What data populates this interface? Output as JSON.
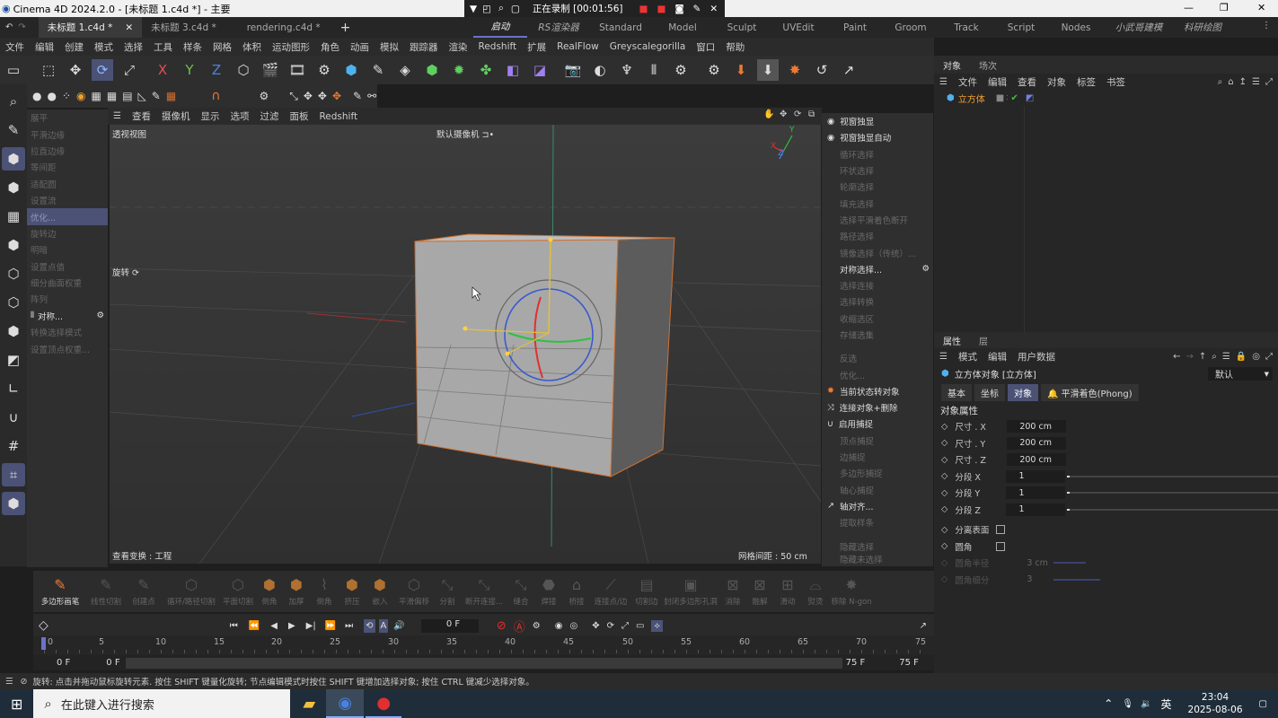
{
  "titlebar": {
    "title": "Cinema 4D 2024.2.0 - [未标题 1.c4d *] - 主要",
    "recording": "正在录制 [00:01:56]"
  },
  "file_tabs": [
    "未标题 1.c4d *",
    "未标题 3.c4d *",
    "rendering.c4d *"
  ],
  "layouts": [
    "启动",
    "RS渲染器",
    "Standard",
    "Model",
    "Sculpt",
    "UVEdit",
    "Paint",
    "Groom",
    "Track",
    "Script",
    "Nodes",
    "小武哥建模",
    "科研绘图"
  ],
  "menu": [
    "文件",
    "编辑",
    "创建",
    "模式",
    "选择",
    "工具",
    "样条",
    "网格",
    "体积",
    "运动图形",
    "角色",
    "动画",
    "模拟",
    "跟踪器",
    "渲染",
    "Redshift",
    "扩展",
    "RealFlow",
    "Greyscalegorilla",
    "窗口",
    "帮助"
  ],
  "left_commands": [
    "展平",
    "平滑边缘",
    "拉直边缘",
    "等间距",
    "适配圆",
    "设置流",
    "优化...",
    "旋转边",
    "明暗",
    "设置点值",
    "细分曲面权重",
    "阵列",
    "对称...",
    "转换选择模式",
    "设置顶点权重..."
  ],
  "viewport": {
    "menu": [
      "查看",
      "摄像机",
      "显示",
      "选项",
      "过滤",
      "面板",
      "Redshift"
    ],
    "label": "透视视图",
    "camera": "默认摄像机",
    "tool": "旋转",
    "footer_left": "查看变换 : 工程",
    "footer_right": "网格间距 : 50 cm",
    "axis_x": "X",
    "axis_y": "Y",
    "axis_z": "Z"
  },
  "right_commands": [
    "视窗独显",
    "视窗独显自动",
    "循环选择",
    "环状选择",
    "轮廓选择",
    "填充选择",
    "选择平滑着色断开",
    "路径选择",
    "镜像选择（传统）...",
    "对称选择...",
    "选择连接",
    "选择转换",
    "收缩选区",
    "存储选集",
    "反选",
    "优化...",
    "当前状态转对象",
    "连接对象+删除",
    "启用捕捉",
    "顶点捕捉",
    "边捕捉",
    "多边形捕捉",
    "轴心捕捉",
    "轴对齐...",
    "提取样条",
    "隐藏选择",
    "隐藏未选择"
  ],
  "object_panel": {
    "tabs": [
      "对象",
      "场次"
    ],
    "menu": [
      "文件",
      "编辑",
      "查看",
      "对象",
      "标签",
      "书签"
    ],
    "object": "立方体"
  },
  "attr_panel": {
    "tabs": [
      "属性",
      "层"
    ],
    "menu": [
      "模式",
      "编辑",
      "用户数据"
    ],
    "title": "立方体对象 [立方体]",
    "preset": "默认",
    "subtabs": [
      "基本",
      "坐标",
      "对象",
      "平滑着色(Phong)"
    ],
    "section": "对象属性",
    "props": [
      {
        "label": "尺寸 . X",
        "value": "200 cm"
      },
      {
        "label": "尺寸 . Y",
        "value": "200 cm"
      },
      {
        "label": "尺寸 . Z",
        "value": "200 cm"
      },
      {
        "label": "分段 X",
        "value": "1"
      },
      {
        "label": "分段 Y",
        "value": "1"
      },
      {
        "label": "分段 Z",
        "value": "1"
      }
    ],
    "checks": [
      "分离表面",
      "圆角"
    ],
    "disabled": [
      {
        "label": "圆角半径",
        "value": "3 cm"
      },
      {
        "label": "圆角细分",
        "value": "3"
      }
    ]
  },
  "bottom_tools": [
    "多边形画笔",
    "线性切割",
    "创建点",
    "循环/路径切割",
    "平面切割",
    "倒角",
    "加厚",
    "倒角",
    "挤压",
    "嵌入",
    "平滑偏移",
    "分割",
    "断开连接...",
    "缝合",
    "焊接",
    "桥接",
    "连接点/边",
    "切割边",
    "封闭多边形孔洞",
    "消除",
    "融解",
    "滑动",
    "熨烫",
    "移除 N-gon"
  ],
  "timeline": {
    "current": "0 F",
    "ticks": [
      "0",
      "5",
      "10",
      "15",
      "20",
      "25",
      "30",
      "35",
      "40",
      "45",
      "50",
      "55",
      "60",
      "65",
      "70",
      "75"
    ],
    "start": "0 F",
    "start2": "0 F",
    "end": "75 F",
    "end2": "75 F"
  },
  "status": "旋转: 点击并拖动鼠标旋转元素. 按住 SHIFT 键量化旋转; 节点编辑模式时按住 SHIFT 键增加选择对象; 按住 CTRL 键减少选择对象。",
  "taskbar": {
    "search": "在此键入进行搜索",
    "ime": "英",
    "time": "23:04",
    "date": "2025-08-06"
  }
}
